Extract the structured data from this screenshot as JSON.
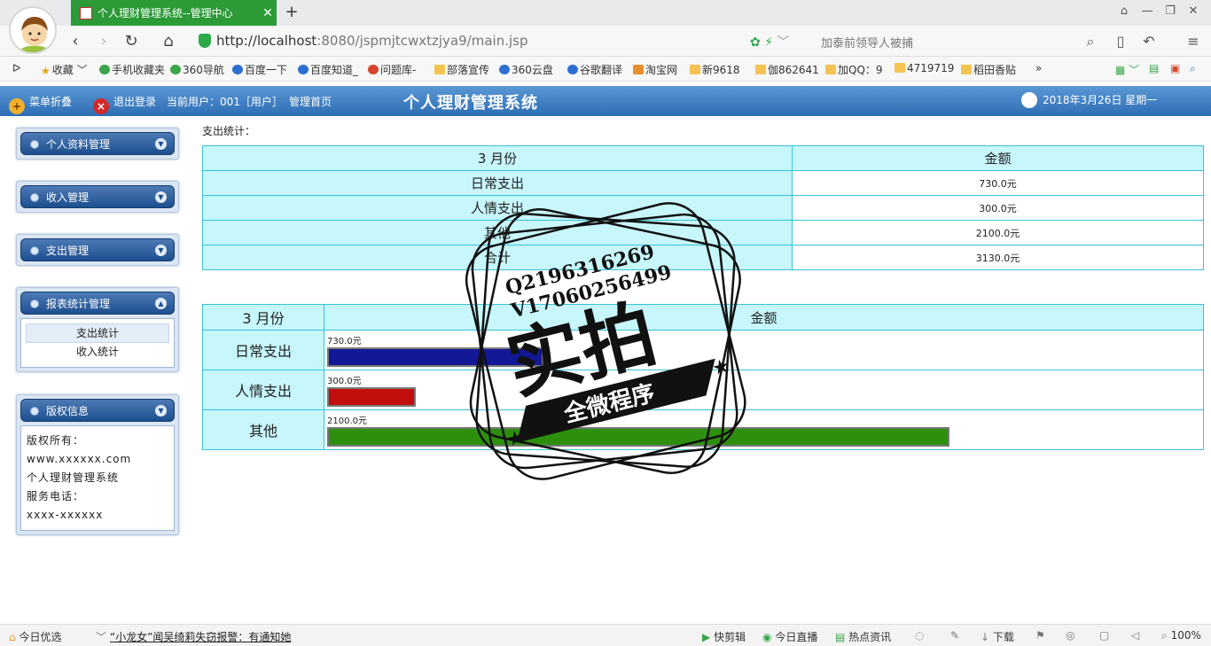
{
  "browser": {
    "tab_title": "个人理财管理系统--管理中心",
    "url_host": "http://localhost",
    "url_rest": ":8080/jspmjtcwxtzjya9/main.jsp",
    "search_placeholder": "加泰前领导人被捕",
    "bookmarks": [
      "收藏",
      "手机收藏夹",
      "360导航",
      "百度一下",
      "百度知道_",
      "问题库-",
      "部落宣传",
      "360云盘",
      "谷歌翻译",
      "淘宝网",
      "新9618",
      "伽862641",
      "加QQ：9",
      "4719719",
      "稻田香贴"
    ]
  },
  "header": {
    "collapse_menu": "菜单折叠",
    "logout": "退出登录",
    "current_user": "当前用户：001［用户］",
    "admin_home": "管理首页",
    "title": "个人理财管理系统",
    "date": "2018年3月26日 星期一"
  },
  "sidebar": {
    "menus": [
      {
        "label": "个人资料管理"
      },
      {
        "label": "收入管理"
      },
      {
        "label": "支出管理"
      },
      {
        "label": "报表统计管理",
        "items": [
          "支出统计",
          "收入统计"
        ]
      },
      {
        "label": "版权信息"
      }
    ],
    "copyright": {
      "line1": "版权所有：",
      "line2": "www.xxxxxx.com",
      "line3": "个人理财管理系统",
      "line4": "服务电话：",
      "line5": "xxxx-xxxxxx"
    }
  },
  "main": {
    "stat_label": "支出统计：",
    "table1": {
      "headers": [
        "3 月份",
        "金额"
      ],
      "rows": [
        {
          "category": "日常支出",
          "amount": "730.0元"
        },
        {
          "category": "人情支出",
          "amount": "300.0元"
        },
        {
          "category": "其他",
          "amount": "2100.0元"
        },
        {
          "category": "合计",
          "amount": "3130.0元"
        }
      ]
    },
    "table2": {
      "headers": [
        "3 月份",
        "金额"
      ],
      "rows": [
        {
          "category": "日常支出",
          "label": "730.0元",
          "value": 730,
          "color": "#121896"
        },
        {
          "category": "人情支出",
          "label": "300.0元",
          "value": 300,
          "color": "#c30e0e"
        },
        {
          "category": "其他",
          "label": "2100.0元",
          "value": 2100,
          "color": "#2d8f0e"
        }
      ]
    }
  },
  "watermark": {
    "line1": "Q2196316269",
    "line2": "V17060256499",
    "main": "实拍",
    "ribbon": "全微程序"
  },
  "statusbar": {
    "left": "今日优选",
    "news": "“小龙女”闻吴绮莉失窃报警：有通知她",
    "items": [
      "快剪辑",
      "今日直播",
      "热点资讯",
      "下载",
      "100%"
    ]
  }
}
